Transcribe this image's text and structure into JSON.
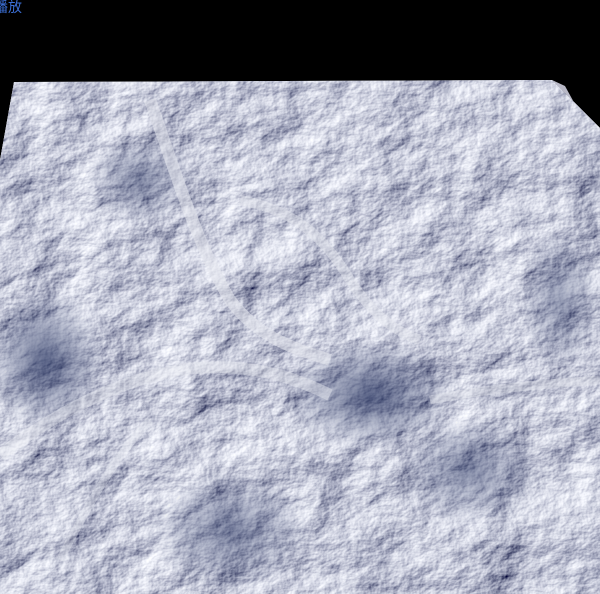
{
  "header": {
    "link_text": "播放"
  },
  "scene": {
    "background_color": "#000000",
    "base_color": "#d4d0ce",
    "snow_color": "#eef0f5",
    "shadow_color": "#2f3f6e",
    "mid_color": "#a9b3ce"
  }
}
